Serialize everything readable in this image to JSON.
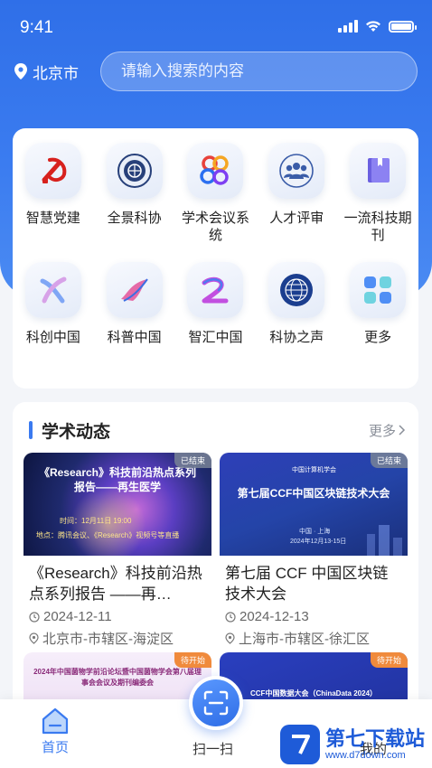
{
  "status": {
    "time": "9:41"
  },
  "header": {
    "location": "北京市",
    "search_placeholder": "请输入搜索的内容"
  },
  "grid": {
    "items": [
      {
        "label": "智慧党建",
        "icon": "party-emblem-icon"
      },
      {
        "label": "全景科协",
        "icon": "association-seal-icon"
      },
      {
        "label": "学术会议系统",
        "icon": "network-rings-icon"
      },
      {
        "label": "人才评审",
        "icon": "people-group-icon"
      },
      {
        "label": "一流科技期刊",
        "icon": "journal-book-icon"
      },
      {
        "label": "科创中国",
        "icon": "kechuang-logo-icon"
      },
      {
        "label": "科普中国",
        "icon": "kepu-logo-icon"
      },
      {
        "label": "智汇中国",
        "icon": "zhihui-logo-icon"
      },
      {
        "label": "科协之声",
        "icon": "globe-seal-icon"
      },
      {
        "label": "更多",
        "icon": "more-grid-icon"
      }
    ]
  },
  "news": {
    "title": "学术动态",
    "more": "更多",
    "cards": [
      {
        "tag": "已结束",
        "cover_title": "《Research》科技前沿热点系列报告——再生医学",
        "cover_sub1": "时间：12月11日 19:00",
        "cover_sub2": "地点：腾讯会议、《Research》视频号等直播",
        "title": "《Research》科技前沿热点系列报告 ——再…",
        "date": "2024-12-11",
        "place": "北京市-市辖区-海淀区"
      },
      {
        "tag": "已结束",
        "cover_org": "中国计算机学会",
        "cover_title": "第七届CCF中国区块链技术大会",
        "cover_sub1": "中国 · 上海",
        "cover_sub2": "2024年12月13-15日",
        "title": "第七届 CCF 中国区块链技术大会",
        "date": "2024-12-13",
        "place": "上海市-市辖区-徐汇区"
      },
      {
        "tag": "待开始",
        "cover_title": "2024年中国菌物学前沿论坛暨中国菌物学会第八届理事会会议及期刊编委会"
      },
      {
        "tag": "待开始",
        "cover_title": "CCF中国数据大会（ChinaData 2024）"
      }
    ]
  },
  "tabbar": {
    "home": "首页",
    "scan": "扫一扫",
    "mine": "我的"
  },
  "watermark": {
    "name": "第七下载站",
    "url": "www.d7down.com"
  },
  "colors": {
    "primary": "#3a7af0",
    "upcoming": "#f08a3c"
  }
}
